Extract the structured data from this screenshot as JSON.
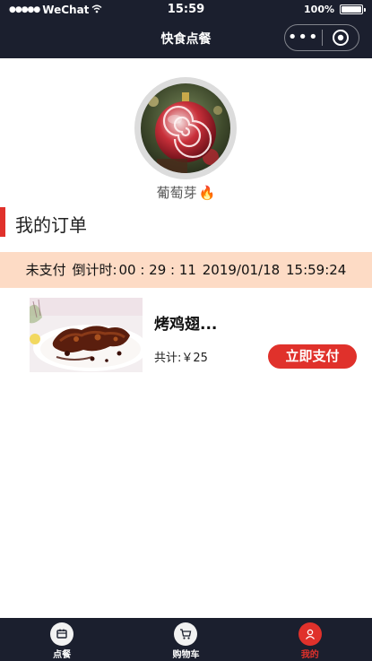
{
  "status_bar": {
    "signal": "●●●●●",
    "carrier": "WeChat",
    "time": "15:59",
    "battery_text": "100%",
    "battery_level": 1.0
  },
  "nav": {
    "title": "快食点餐",
    "more_label": "•••"
  },
  "profile": {
    "nickname": "葡萄芽",
    "nickname_emoji": "🔥"
  },
  "section": {
    "title": "我的订单"
  },
  "order": {
    "status": "未支付",
    "countdown_label": "倒计时:",
    "countdown": "00 : 29 : 11",
    "date": "2019/01/18",
    "time": "15:59:24",
    "item_name": "烤鸡翅...",
    "total_label": "共计:",
    "total_amount": "￥25",
    "pay_button": "立即支付"
  },
  "tabbar": {
    "items": [
      {
        "label": "点餐",
        "icon": "menu-icon",
        "active": false
      },
      {
        "label": "购物车",
        "icon": "cart-icon",
        "active": false
      },
      {
        "label": "我的",
        "icon": "user-icon",
        "active": true
      }
    ]
  },
  "colors": {
    "nav_bg": "#1b1f2e",
    "accent": "#e0312b",
    "status_strip": "#fddbc5"
  }
}
